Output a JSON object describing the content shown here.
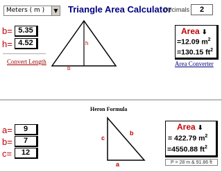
{
  "header": {
    "units_select": "Meters ( m )",
    "title": "Triangle Area Calculator",
    "decimals_label": "Decimals :",
    "decimals_value": "2"
  },
  "triangle_calc": {
    "b_label": "b=",
    "b_value": "5.35",
    "h_label": "h=",
    "h_value": "4.52",
    "convert_length_link": "Convert Length",
    "diagram_h_label": "h",
    "diagram_b_label": "b",
    "result": {
      "title": "Area",
      "line1": "=12.09 m",
      "line1_exp": "2",
      "line2": "=130.15 ft",
      "line2_exp": "2"
    },
    "area_converter_link": "Area Converter"
  },
  "heron_calc": {
    "section_title": "Heron Formula",
    "a_label": "a=",
    "a_value": "9",
    "b_label": "b=",
    "b_value": "7",
    "c_label": "c=",
    "c_value": "12",
    "diagram_a_label": "a",
    "diagram_b_label": "b",
    "diagram_c_label": "c",
    "result": {
      "title": "Area",
      "line1": "= 422.79 m",
      "line1_exp": "2",
      "line2": "=4550.88 ft",
      "line2_exp": "2"
    },
    "perimeter": "P = 28 m & 91.86 ft"
  },
  "colors": {
    "title": "#000080",
    "label_red": "#c00000",
    "link_red": "#a00000",
    "link_blue": "#000080"
  },
  "icons": {
    "dropdown": "chevron-down-icon",
    "area_arrow": "arrow-down-icon"
  }
}
